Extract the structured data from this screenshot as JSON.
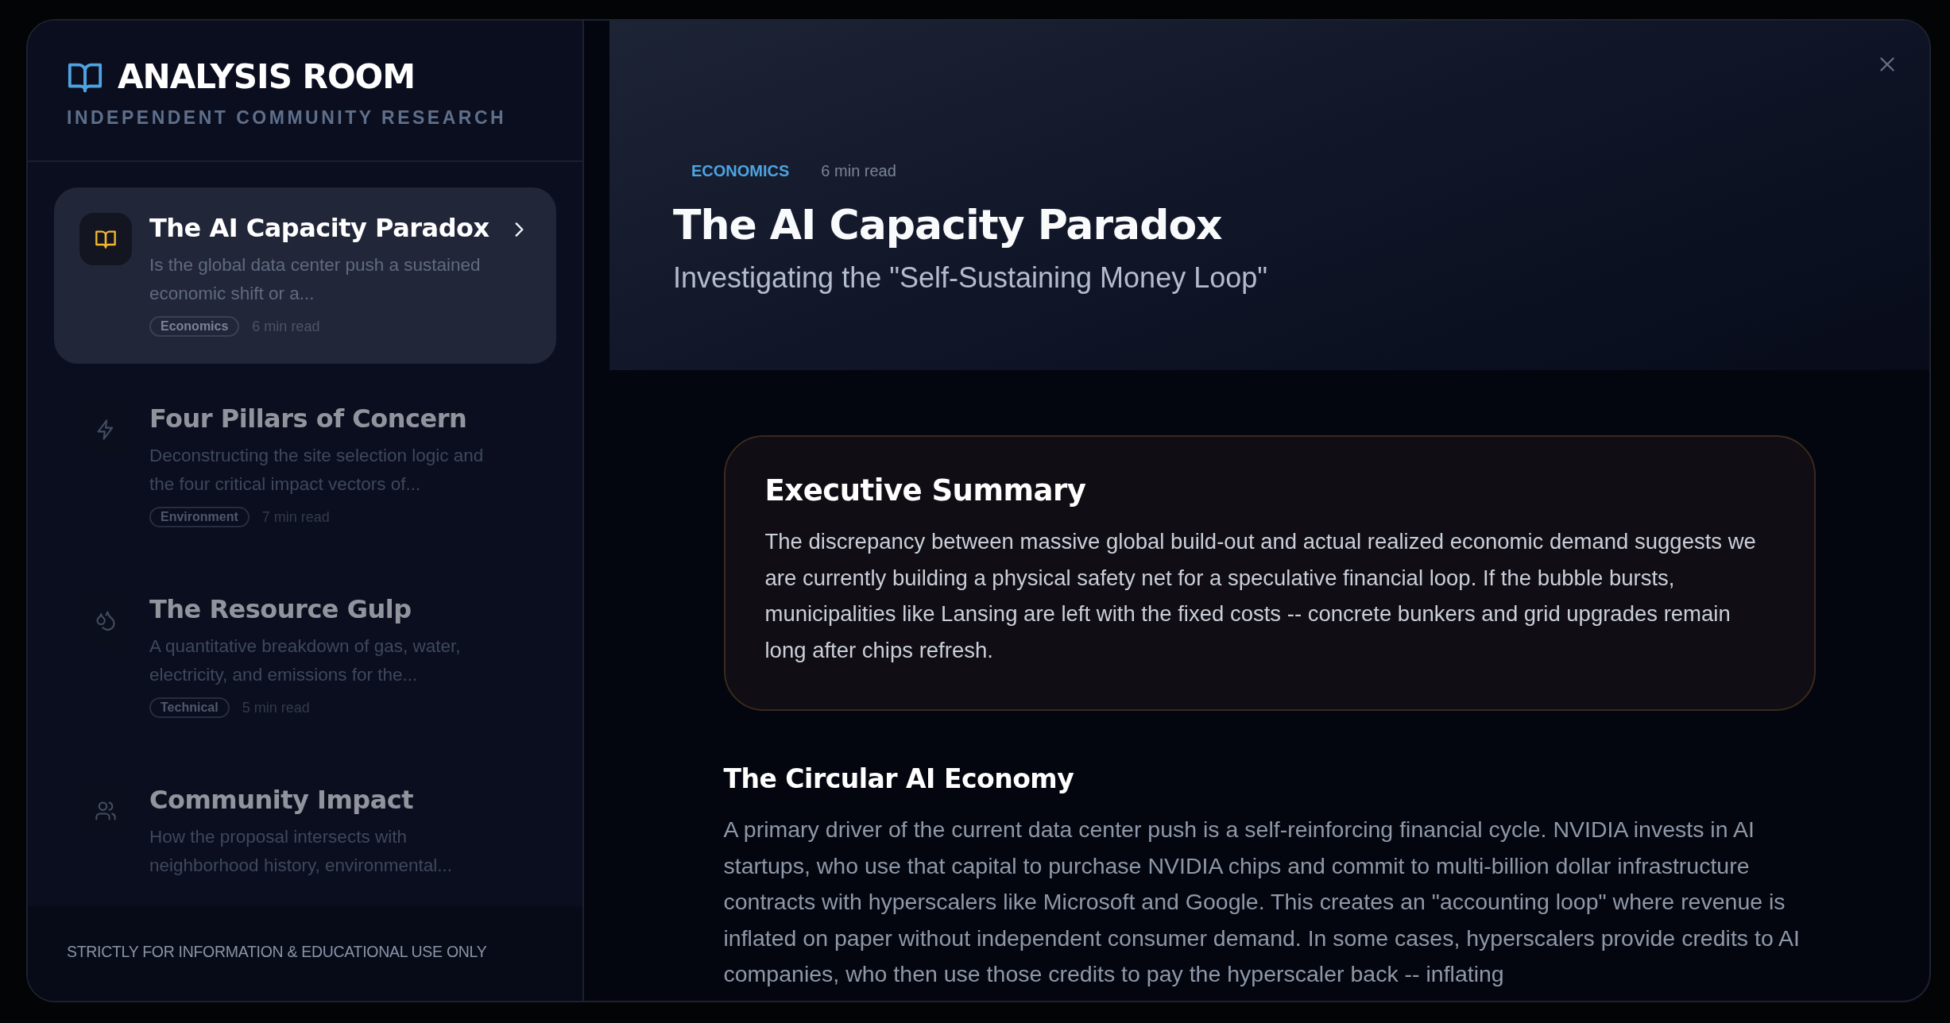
{
  "sidebar": {
    "brand": {
      "title": "ANALYSIS ROOM",
      "subtitle": "INDEPENDENT COMMUNITY RESEARCH"
    },
    "items": [
      {
        "title": "The AI Capacity Paradox",
        "description": "Is the global data center push a sustained economic shift or a...",
        "tag": "Economics",
        "read_time": "6 min read",
        "selected": true
      },
      {
        "title": "Four Pillars of Concern",
        "description": "Deconstructing the site selection logic and the four critical impact vectors of...",
        "tag": "Environment",
        "read_time": "7 min read",
        "selected": false
      },
      {
        "title": "The Resource Gulp",
        "description": "A quantitative breakdown of gas, water, electricity, and emissions for the...",
        "tag": "Technical",
        "read_time": "5 min read",
        "selected": false
      },
      {
        "title": "Community Impact",
        "description": "How the proposal intersects with neighborhood history, environmental...",
        "selected": false
      }
    ],
    "footer": "STRICTLY FOR INFORMATION & EDUCATIONAL USE ONLY"
  },
  "article": {
    "category": "ECONOMICS",
    "read_time": "6 min read",
    "title": "The AI Capacity Paradox",
    "subtitle": "Investigating the \"Self-Sustaining Money Loop\"",
    "summary": {
      "heading": "Executive Summary",
      "text": "The discrepancy between massive global build-out and actual realized economic demand suggests we are currently building a physical safety net for a speculative financial loop. If the bubble bursts, municipalities like Lansing are left with the fixed costs -- concrete bunkers and grid upgrades remain long after chips refresh."
    },
    "sections": [
      {
        "heading": "The Circular AI Economy",
        "text": "A primary driver of the current data center push is a self-reinforcing financial cycle. NVIDIA invests in AI startups, who use that capital to purchase NVIDIA chips and commit to multi-billion dollar infrastructure contracts with hyperscalers like Microsoft and Google. This creates an \"accounting loop\" where revenue is inflated on paper without independent consumer demand. In some cases, hyperscalers provide credits to AI companies, who then use those credits to pay the hyperscaler back -- inflating"
      }
    ]
  }
}
